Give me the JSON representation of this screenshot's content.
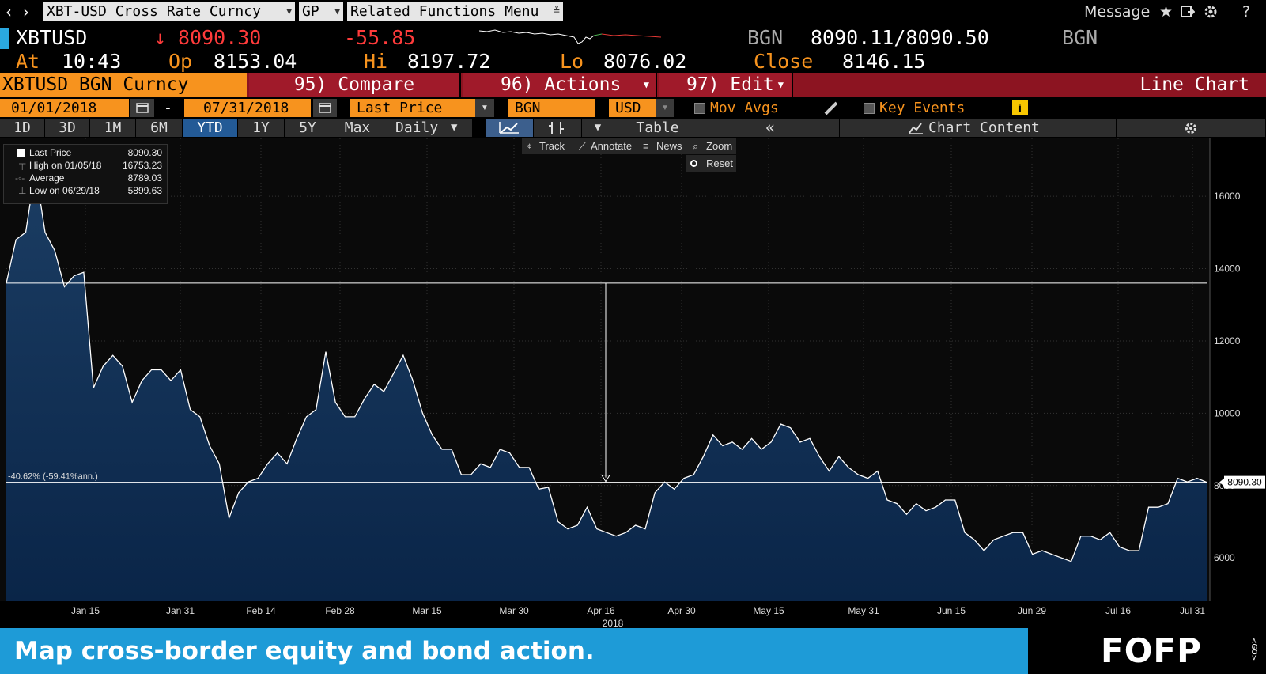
{
  "toolbar": {
    "back": "‹",
    "forward": "›",
    "security": "XBT-USD Cross Rate Curncy",
    "function": "GP",
    "related": "Related Functions  Menu",
    "message": "Message",
    "star": "★",
    "help": "?"
  },
  "quote": {
    "ticker": "XBTUSD",
    "arrow": "↓",
    "last": "8090.30",
    "change": "-55.85",
    "source_left": "BGN",
    "bid_ask": "8090.11/8090.50",
    "source_right": "BGN",
    "at_label": "At",
    "time": "10:43",
    "op_label": "Op",
    "open": "8153.04",
    "hi_label": "Hi",
    "high": "8197.72",
    "lo_label": "Lo",
    "low": "8076.02",
    "close_label": "Close",
    "close": "8146.15"
  },
  "tabs": {
    "title": "XBTUSD BGN Curncy",
    "compare": "95) Compare",
    "actions": "96) Actions",
    "edit": "97) Edit",
    "chart_type": "Line Chart"
  },
  "settings": {
    "start_date": "01/01/2018",
    "dash": "-",
    "end_date": "07/31/2018",
    "field": "Last Price",
    "source": "BGN",
    "currency": "USD",
    "mov_avgs": "Mov Avgs",
    "key_events": "Key Events",
    "info": "i"
  },
  "periods": [
    "1D",
    "3D",
    "1M",
    "6M",
    "YTD",
    "1Y",
    "5Y",
    "Max"
  ],
  "active_period": "YTD",
  "frequency": "Daily",
  "table_label": "Table",
  "collapse": "«",
  "chart_content": "Chart Content",
  "chart_tools": {
    "track": "Track",
    "annotate": "Annotate",
    "news": "News",
    "zoom": "Zoom",
    "reset": "Reset"
  },
  "legend": [
    {
      "label": "Last Price",
      "value": "8090.30"
    },
    {
      "label": "High on 01/05/18",
      "value": "16753.23"
    },
    {
      "label": "Average",
      "value": "8789.03"
    },
    {
      "label": "Low on 06/29/18",
      "value": "5899.63"
    }
  ],
  "chart_data": {
    "type": "area",
    "series": [
      {
        "name": "Last Price",
        "color": "#ffffff",
        "fill": "#0d2848"
      }
    ],
    "ylim": [
      4800,
      17600
    ],
    "yticks": [
      6000,
      8000,
      10000,
      12000,
      14000,
      16000
    ],
    "xticks": [
      "Jan 15",
      "Jan 31",
      "Feb 14",
      "Feb 28",
      "Mar 15",
      "Mar 30",
      "Apr 16",
      "Apr 30",
      "May 15",
      "May 31",
      "Jun 15",
      "Jun 29",
      "Jul 16",
      "Jul 31"
    ],
    "year_label": "2018",
    "x": [
      "01/01",
      "01/03",
      "01/05",
      "01/06",
      "01/08",
      "01/10",
      "01/12",
      "01/13",
      "01/15",
      "01/16",
      "01/17",
      "01/19",
      "01/20",
      "01/22",
      "01/23",
      "01/25",
      "01/26",
      "01/28",
      "01/30",
      "01/31",
      "02/01",
      "02/02",
      "02/04",
      "02/05",
      "02/07",
      "02/08",
      "02/10",
      "02/11",
      "02/13",
      "02/15",
      "02/16",
      "02/18",
      "02/20",
      "02/22",
      "02/24",
      "02/26",
      "02/27",
      "02/28",
      "03/01",
      "03/03",
      "03/05",
      "03/06",
      "03/08",
      "03/10",
      "03/12",
      "03/14",
      "03/16",
      "03/17",
      "03/19",
      "03/21",
      "03/23",
      "03/25",
      "03/27",
      "03/29",
      "03/31",
      "04/01",
      "04/03",
      "04/05",
      "04/07",
      "04/09",
      "04/11",
      "04/12",
      "04/14",
      "04/16",
      "04/18",
      "04/20",
      "04/22",
      "04/24",
      "04/26",
      "04/28",
      "04/30",
      "05/02",
      "05/04",
      "05/06",
      "05/08",
      "05/10",
      "05/12",
      "05/14",
      "05/16",
      "05/18",
      "05/20",
      "05/22",
      "05/24",
      "05/26",
      "05/28",
      "05/30",
      "06/01",
      "06/03",
      "06/05",
      "06/07",
      "06/09",
      "06/11",
      "06/13",
      "06/15",
      "06/17",
      "06/19",
      "06/21",
      "06/23",
      "06/25",
      "06/27",
      "06/29",
      "07/01",
      "07/03",
      "07/05",
      "07/07",
      "07/09",
      "07/11",
      "07/13",
      "07/15",
      "07/17",
      "07/19",
      "07/21",
      "07/23",
      "07/25",
      "07/27",
      "07/29",
      "07/31"
    ],
    "values": [
      13600,
      14800,
      15000,
      16753,
      15000,
      14500,
      13500,
      13800,
      13900,
      10700,
      11300,
      11600,
      11300,
      10300,
      10900,
      11200,
      11200,
      10900,
      11200,
      10100,
      9900,
      9100,
      8600,
      7100,
      7800,
      8100,
      8200,
      8600,
      8900,
      8600,
      9300,
      9900,
      10100,
      11700,
      10300,
      9900,
      9900,
      10400,
      10800,
      10600,
      11100,
      11600,
      10900,
      10000,
      9400,
      9000,
      9000,
      8300,
      8300,
      8600,
      8500,
      9000,
      8900,
      8500,
      8500,
      7900,
      7950,
      7000,
      6800,
      6900,
      7400,
      6800,
      6700,
      6600,
      6700,
      6900,
      6800,
      7800,
      8100,
      7900,
      8200,
      8300,
      8800,
      9400,
      9100,
      9200,
      9000,
      9300,
      9000,
      9200,
      9700,
      9600,
      9200,
      9300,
      8800,
      8400,
      8800,
      8500,
      8300,
      8200,
      8400,
      7600,
      7500,
      7200,
      7500,
      7300,
      7400,
      7600,
      7600,
      6700,
      6500,
      6200,
      6500,
      6600,
      6700,
      6700,
      6100,
      6200,
      6100,
      6000,
      5900,
      6600,
      6600,
      6500,
      6700,
      6300,
      6200,
      6200,
      7400,
      7400,
      7500,
      8200,
      8100,
      8200,
      8090
    ],
    "annotations": {
      "start_value": 13600,
      "return_label": "-40.62% (-59.41%ann.)",
      "last_label": "8090.30"
    }
  },
  "ad": {
    "text": "Map cross-border equity and bond action.",
    "brand": "FOFP",
    "brand_suffix": "<GO>"
  }
}
